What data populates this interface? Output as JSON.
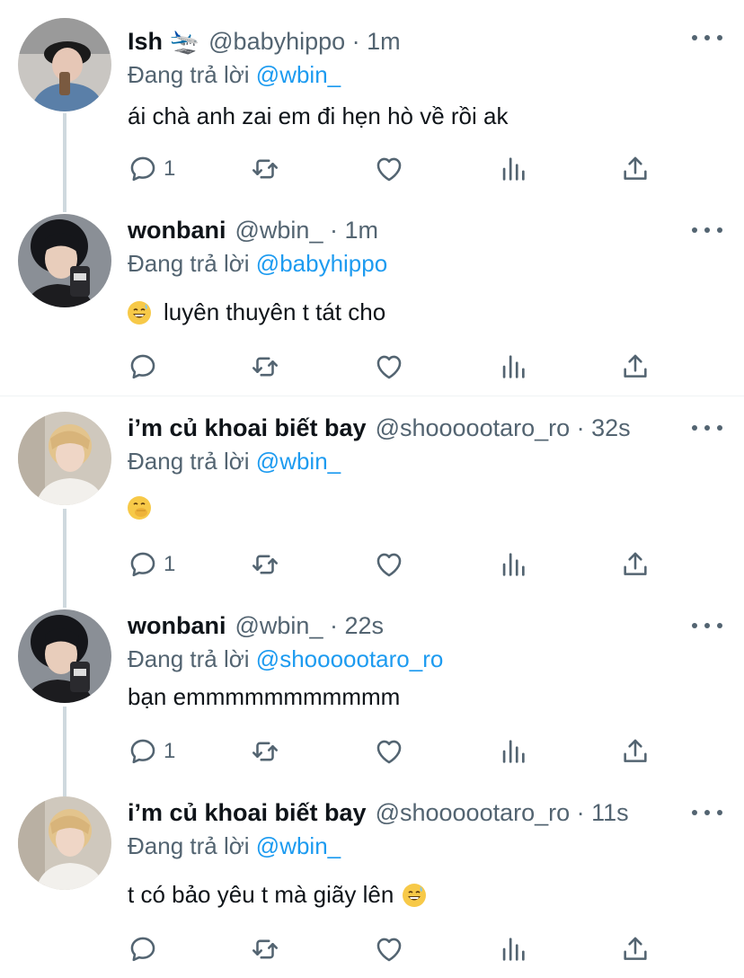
{
  "tweets": [
    {
      "name": "Ish 🛬",
      "meta": "@babyhippo · 1m",
      "reply_prefix": "Đang trả lời",
      "reply_to": "@wbin_",
      "text": "ái chà anh zai em đi hẹn hò về rồi ak",
      "reply_count": "1"
    },
    {
      "name": "wonbani",
      "meta": "@wbin_ · 1m",
      "reply_prefix": "Đang trả lời",
      "reply_to": "@babyhippo",
      "text": "luyên thuyên t tát cho",
      "reply_count": ""
    },
    {
      "name": "i’m củ khoai biết bay",
      "meta": "@shoooootaro_ro · 32s",
      "reply_prefix": "Đang trả lời",
      "reply_to": "@wbin_",
      "text": "",
      "reply_count": "1"
    },
    {
      "name": "wonbani",
      "meta": "@wbin_ · 22s",
      "reply_prefix": "Đang trả lời",
      "reply_to": "@shoooootaro_ro",
      "text": "bạn emmmmmmmmmmm",
      "reply_count": "1"
    },
    {
      "name": "i’m củ khoai biết bay",
      "meta": "@shoooootaro_ro · 11s",
      "reply_prefix": "Đang trả lời",
      "reply_to": "@wbin_",
      "text": "t có bảo yêu t mà giãy lên",
      "reply_count": ""
    }
  ],
  "icons": [
    "reply-icon",
    "retweet-icon",
    "like-icon",
    "analytics-icon",
    "share-icon",
    "more-icon"
  ],
  "colors": {
    "link": "#1d9bf0",
    "secondary": "#536471",
    "text": "#0f1419"
  }
}
